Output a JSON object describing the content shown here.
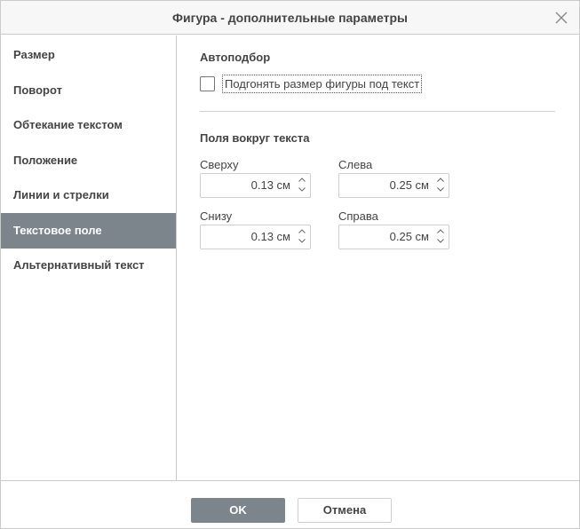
{
  "dialog": {
    "title": "Фигура - дополнительные параметры",
    "close_icon": "close-icon"
  },
  "sidebar": {
    "items": [
      {
        "label": "Размер",
        "active": false
      },
      {
        "label": "Поворот",
        "active": false
      },
      {
        "label": "Обтекание текстом",
        "active": false
      },
      {
        "label": "Положение",
        "active": false
      },
      {
        "label": "Линии и стрелки",
        "active": false
      },
      {
        "label": "Текстовое поле",
        "active": true
      },
      {
        "label": "Альтернативный текст",
        "active": false
      }
    ]
  },
  "content": {
    "autofit": {
      "title": "Автоподбор",
      "checkbox_label": "Подгонять размер фигуры под текст",
      "checked": false
    },
    "margins": {
      "title": "Поля вокруг текста",
      "top": {
        "label": "Сверху",
        "value": "0.13 см"
      },
      "left": {
        "label": "Слева",
        "value": "0.25 см"
      },
      "bottom": {
        "label": "Снизу",
        "value": "0.13 см"
      },
      "right": {
        "label": "Справа",
        "value": "0.25 см"
      }
    }
  },
  "footer": {
    "ok_label": "OK",
    "cancel_label": "Отмена"
  },
  "colors": {
    "accent": "#7d858c",
    "border": "#cbcbcb",
    "text": "#444444"
  }
}
